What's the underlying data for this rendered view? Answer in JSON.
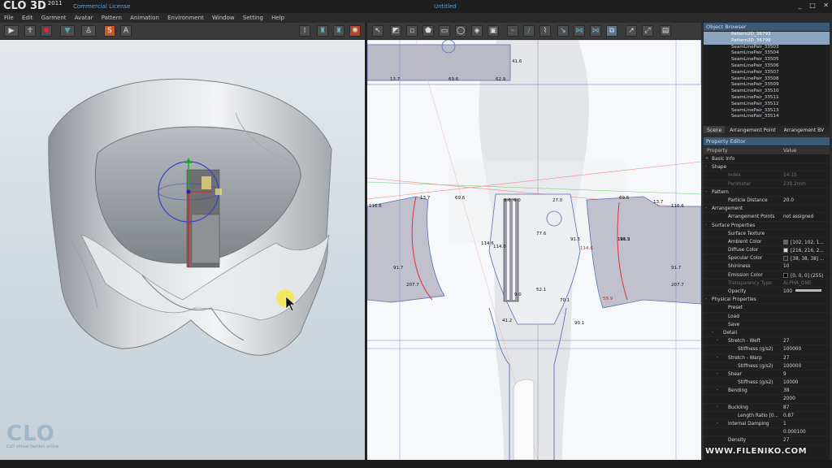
{
  "app": {
    "logo": "CLO 3D",
    "logo_year": "2011",
    "license": "Commercial License",
    "doc_title": "Untitled"
  },
  "window_controls": [
    "_",
    "□",
    "✕"
  ],
  "menu": [
    "File",
    "Edit",
    "Garment",
    "Avatar",
    "Pattern",
    "Animation",
    "Environment",
    "Window",
    "Setting",
    "Help"
  ],
  "toolbar3d": {
    "icons": [
      "play-icon",
      "walk-icon",
      "record-icon",
      "shirt-icon",
      "avatar-icon",
      "texture-s-icon",
      "texture-a-icon",
      "grid-dots-icon",
      "garment-front-icon",
      "garment-back-icon",
      "simulate-icon"
    ]
  },
  "toolbar2d": {
    "icons": [
      "select-icon",
      "edit-pattern-icon",
      "add-point-icon",
      "polygon-icon",
      "rectangle-icon",
      "ellipse-icon",
      "dart-icon",
      "segment-icon",
      "internal-line-icon",
      "trace-icon",
      "fold-icon",
      "sew-icon",
      "seam-free-icon",
      "symmetric-icon",
      "copy-icon",
      "notch-icon",
      "measure-icon"
    ]
  },
  "viewport3d": {
    "brand": "CLO",
    "tagline": "CLO virtual fashion online"
  },
  "pattern_labels": [
    "41.6",
    "13.7",
    "69.6",
    "62.9",
    "13.7",
    "69.6",
    "27.0",
    "9.0",
    "69.6",
    "13.7",
    "116.6",
    "116.6",
    "91.7",
    "91.7",
    "207.7",
    "207.7",
    "114.6",
    "114.6",
    "77.6",
    "91.5",
    "91.5",
    "52.1",
    "70.1",
    "41.2",
    "90.1",
    "59.9",
    "106.2",
    "114.6",
    "9.0",
    "9.0"
  ],
  "object_browser": {
    "title": "Object Browser",
    "items": [
      {
        "label": "Pattern2D_36793",
        "selected": true
      },
      {
        "label": "Pattern2D_36799",
        "selected": true
      },
      {
        "label": "SeamLinePair_33503",
        "selected": false
      },
      {
        "label": "SeamLinePair_33504",
        "selected": false
      },
      {
        "label": "SeamLinePair_33505",
        "selected": false
      },
      {
        "label": "SeamLinePair_33506",
        "selected": false
      },
      {
        "label": "SeamLinePair_33507",
        "selected": false
      },
      {
        "label": "SeamLinePair_33508",
        "selected": false
      },
      {
        "label": "SeamLinePair_33509",
        "selected": false
      },
      {
        "label": "SeamLinePair_33510",
        "selected": false
      },
      {
        "label": "SeamLinePair_33511",
        "selected": false
      },
      {
        "label": "SeamLinePair_33512",
        "selected": false
      },
      {
        "label": "SeamLinePair_33513",
        "selected": false
      },
      {
        "label": "SeamLinePair_33514",
        "selected": false
      }
    ],
    "tabs": [
      "Scene",
      "Arrangement Point",
      "Arrangement BV"
    ]
  },
  "property_editor": {
    "title": "Property Editor",
    "col_property": "Property",
    "col_value": "Value",
    "rows": [
      {
        "key": "Basic Info",
        "value": "",
        "level": 0,
        "exp": "+",
        "dim": false,
        "swatch": ""
      },
      {
        "key": "Shape",
        "value": "",
        "level": 0,
        "exp": "-",
        "dim": false,
        "swatch": ""
      },
      {
        "key": "Index",
        "value": "14:15",
        "level": 2,
        "exp": "",
        "dim": true,
        "swatch": ""
      },
      {
        "key": "Perimeter",
        "value": "239.2mm",
        "level": 2,
        "exp": "",
        "dim": true,
        "swatch": ""
      },
      {
        "key": "Pattern",
        "value": "",
        "level": 0,
        "exp": "-",
        "dim": false,
        "swatch": ""
      },
      {
        "key": "Particle Distance",
        "value": "20.0",
        "level": 2,
        "exp": "",
        "dim": false,
        "swatch": ""
      },
      {
        "key": "Arrangement",
        "value": "",
        "level": 0,
        "exp": "-",
        "dim": false,
        "swatch": ""
      },
      {
        "key": "Arrangement Points",
        "value": "not assigned",
        "level": 2,
        "exp": "",
        "dim": false,
        "swatch": ""
      },
      {
        "key": "Surface Properties",
        "value": "",
        "level": 0,
        "exp": "-",
        "dim": false,
        "swatch": ""
      },
      {
        "key": "Surface Texture",
        "value": "",
        "level": 2,
        "exp": "",
        "dim": false,
        "swatch": ""
      },
      {
        "key": "Ambient Color",
        "value": "[102, 102, 1...",
        "level": 2,
        "exp": "",
        "dim": false,
        "swatch": "#666666"
      },
      {
        "key": "Diffuse Color",
        "value": "[216, 216, 2...",
        "level": 2,
        "exp": "",
        "dim": false,
        "swatch": "#d8d8d8"
      },
      {
        "key": "Specular Color",
        "value": "[38, 38, 38] ...",
        "level": 2,
        "exp": "",
        "dim": false,
        "swatch": "#262626"
      },
      {
        "key": "Shininess",
        "value": "10",
        "level": 2,
        "exp": "",
        "dim": false,
        "swatch": ""
      },
      {
        "key": "Emission Color",
        "value": "[0, 0, 0] (255)",
        "level": 2,
        "exp": "",
        "dim": false,
        "swatch": "#000000"
      },
      {
        "key": "Transparency Type",
        "value": "ALPHA_ONE",
        "level": 2,
        "exp": "",
        "dim": true,
        "swatch": ""
      },
      {
        "key": "Opacity",
        "value": "100",
        "level": 2,
        "exp": "",
        "dim": false,
        "swatch": ""
      },
      {
        "key": "Physical Properties",
        "value": "",
        "level": 0,
        "exp": "-",
        "dim": false,
        "swatch": ""
      },
      {
        "key": "Preset",
        "value": "",
        "level": 2,
        "exp": "",
        "dim": false,
        "swatch": ""
      },
      {
        "key": "Load",
        "value": "",
        "level": 2,
        "exp": "",
        "dim": false,
        "swatch": ""
      },
      {
        "key": "Save",
        "value": "",
        "level": 2,
        "exp": "",
        "dim": false,
        "swatch": ""
      },
      {
        "key": "Detail",
        "value": "",
        "level": 1,
        "exp": "-",
        "dim": false,
        "swatch": ""
      },
      {
        "key": "Stretch - Weft",
        "value": "27",
        "level": 2,
        "exp": "-",
        "dim": false,
        "swatch": ""
      },
      {
        "key": "Stiffness (g/s2)",
        "value": "100000",
        "level": 3,
        "exp": "",
        "dim": false,
        "swatch": ""
      },
      {
        "key": "Stretch - Warp",
        "value": "27",
        "level": 2,
        "exp": "-",
        "dim": false,
        "swatch": ""
      },
      {
        "key": "Stiffness (g/s2)",
        "value": "100000",
        "level": 3,
        "exp": "",
        "dim": false,
        "swatch": ""
      },
      {
        "key": "Shear",
        "value": "9",
        "level": 2,
        "exp": "-",
        "dim": false,
        "swatch": ""
      },
      {
        "key": "Stiffness (g/s2)",
        "value": "10000",
        "level": 3,
        "exp": "",
        "dim": false,
        "swatch": ""
      },
      {
        "key": "Bending",
        "value": "38",
        "level": 2,
        "exp": "-",
        "dim": false,
        "swatch": ""
      },
      {
        "key": "",
        "value": "2000",
        "level": 3,
        "exp": "",
        "dim": false,
        "swatch": ""
      },
      {
        "key": "Buckling",
        "value": "87",
        "level": 2,
        "exp": "-",
        "dim": false,
        "swatch": ""
      },
      {
        "key": "Length Ratio [0...",
        "value": "0.87",
        "level": 3,
        "exp": "",
        "dim": false,
        "swatch": ""
      },
      {
        "key": "Internal Damping",
        "value": "1",
        "level": 2,
        "exp": "-",
        "dim": false,
        "swatch": ""
      },
      {
        "key": "",
        "value": "0.000100",
        "level": 3,
        "exp": "",
        "dim": false,
        "swatch": ""
      },
      {
        "key": "Density",
        "value": "27",
        "level": 2,
        "exp": "",
        "dim": false,
        "swatch": ""
      }
    ]
  },
  "watermark": "WWW.FILENIKO.COM",
  "colors": {
    "accent": "#59a6e0",
    "panel_header": "#3a5a78",
    "selected": "#8aa4bf"
  }
}
